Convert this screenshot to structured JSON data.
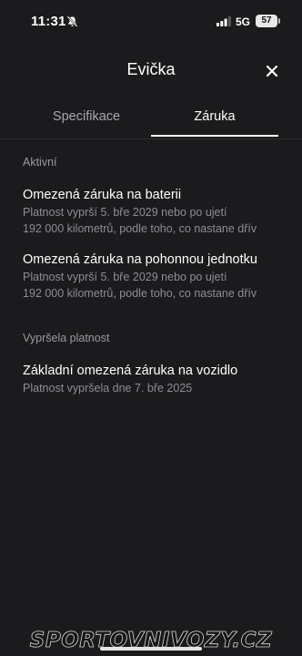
{
  "status_bar": {
    "time": "11:31",
    "network": "5G",
    "battery": "57"
  },
  "header": {
    "title": "Evička"
  },
  "tabs": [
    {
      "label": "Specifikace",
      "active": false
    },
    {
      "label": "Záruka",
      "active": true
    }
  ],
  "sections": [
    {
      "label": "Aktivní",
      "items": [
        {
          "title": "Omezená záruka na baterii",
          "desc_line1": "Platnost vyprší 5. bře 2029 nebo po ujetí",
          "desc_line2": "192 000 kilometrů, podle toho, co nastane dřív"
        },
        {
          "title": "Omezená záruka na pohonnou jednotku",
          "desc_line1": "Platnost vyprší 5. bře 2029 nebo po ujetí",
          "desc_line2": "192 000 kilometrů, podle toho, co nastane dřív"
        }
      ]
    },
    {
      "label": "Vypršela platnost",
      "items": [
        {
          "title": "Základní omezená záruka na vozidlo",
          "desc_line1": "Platnost vypršela dne 7. bře 2025"
        }
      ]
    }
  ],
  "watermark": "SPORTOVNIVOZY.CZ",
  "colors": {
    "background": "#1b1b1d",
    "primary_text": "#ffffff",
    "secondary_text": "#8e8e93",
    "active_tab_underline": "#ffffff"
  }
}
